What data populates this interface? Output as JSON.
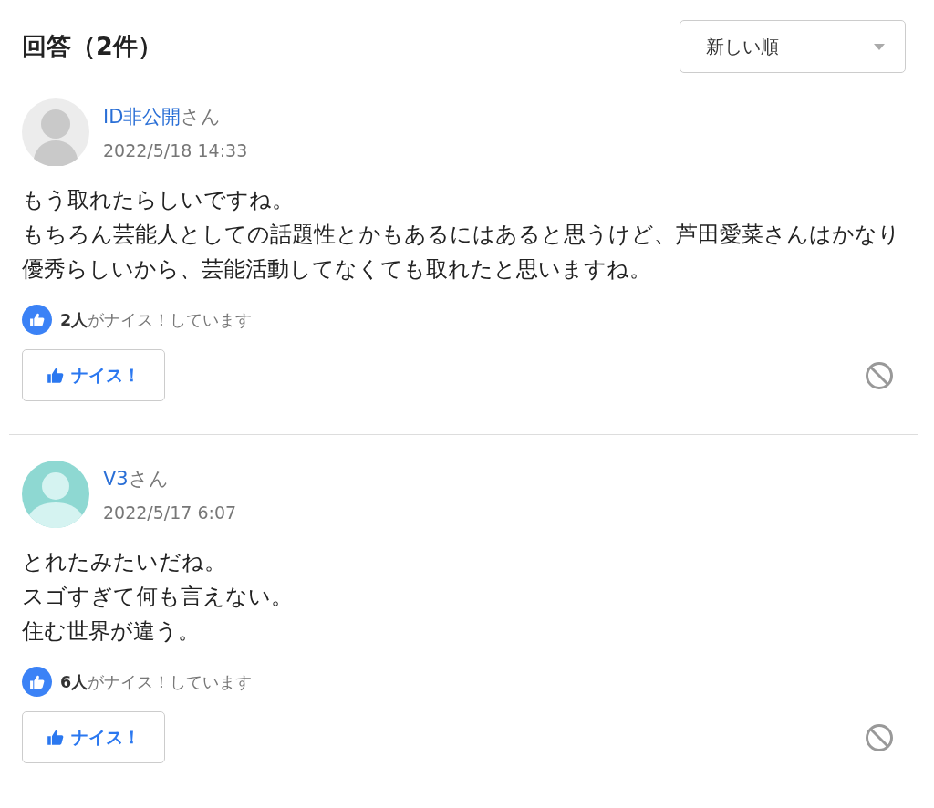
{
  "header": {
    "title": "回答（2件）",
    "sort": {
      "value": "新しい順"
    }
  },
  "answers": [
    {
      "avatar": {
        "kind": "anonymous"
      },
      "name": "ID非公開",
      "suffix": "さん",
      "date": "2022/5/18 14:33",
      "lines": [
        "もう取れたらしいですね。",
        "もちろん芸能人としての話題性とかもあるにはあると思うけど、芦田愛菜さんはかなり優秀らしいから、芸能活動してなくても取れたと思いますね。"
      ],
      "nice_count": "**2人**がナイス！しています",
      "nice_button": "ナイス！"
    },
    {
      "avatar": {
        "kind": "teal"
      },
      "name": "V3",
      "suffix": "さん",
      "date": "2022/5/17 6:07",
      "lines": [
        "とれたみたいだね。",
        "スゴすぎて何も言えない。",
        "住む世界が違う。"
      ],
      "nice_count": "**6人**がナイス！しています",
      "nice_button": "ナイス！"
    }
  ]
}
